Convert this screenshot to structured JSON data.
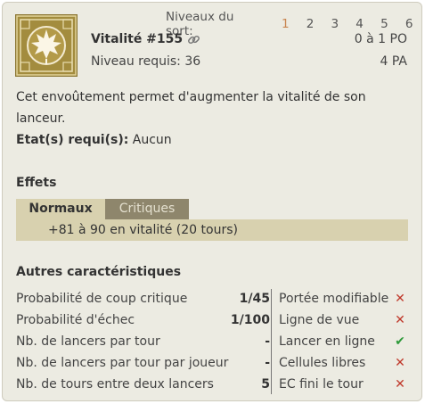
{
  "spell": {
    "levels_label": "Niveaux du sort:",
    "levels": [
      "1",
      "2",
      "3",
      "4",
      "5",
      "6"
    ],
    "active_level": "1",
    "name": "Vitalité #155",
    "required_level": "Niveau requis: 36",
    "range": "0 à 1 PO",
    "ap_cost": "4 PA",
    "description": "Cet envoûtement permet d'augmenter la vitalité de son lanceur.",
    "required_states_label": "Etat(s) requi(s):",
    "required_states_value": "Aucun"
  },
  "effects": {
    "title": "Effets",
    "tabs": [
      "Normaux",
      "Critiques"
    ],
    "active_tab": "Normaux",
    "normal": [
      "+81 à 90 en vitalité (20 tours)"
    ]
  },
  "other": {
    "title": "Autres caractéristiques",
    "stats": [
      {
        "label": "Probabilité de coup critique",
        "value": "1/45"
      },
      {
        "label": "Probabilité d'échec",
        "value": "1/100"
      },
      {
        "label": "Nb. de lancers par tour",
        "value": "-"
      },
      {
        "label": "Nb. de lancers par tour par joueur",
        "value": "-"
      },
      {
        "label": "Nb. de tours entre deux lancers",
        "value": "5"
      }
    ],
    "flags": [
      {
        "label": "Portée modifiable",
        "mark": "✕"
      },
      {
        "label": "Ligne de vue",
        "mark": "✕"
      },
      {
        "label": "Lancer en ligne",
        "mark": "✔"
      },
      {
        "label": "Cellules libres",
        "mark": "✕"
      },
      {
        "label": "EC fini le tour",
        "mark": "✕"
      }
    ]
  },
  "colors": {
    "panel_bg": "#ecebe2",
    "tab_active": "#d8d1af",
    "tab_inactive": "#8e866c",
    "active_level": "#c8844f",
    "no_mark": "#c0392b",
    "yes_mark": "#2e9a3a"
  },
  "icons": [
    "spell-icon-leaf",
    "link-icon",
    "cross-icon",
    "check-icon"
  ]
}
